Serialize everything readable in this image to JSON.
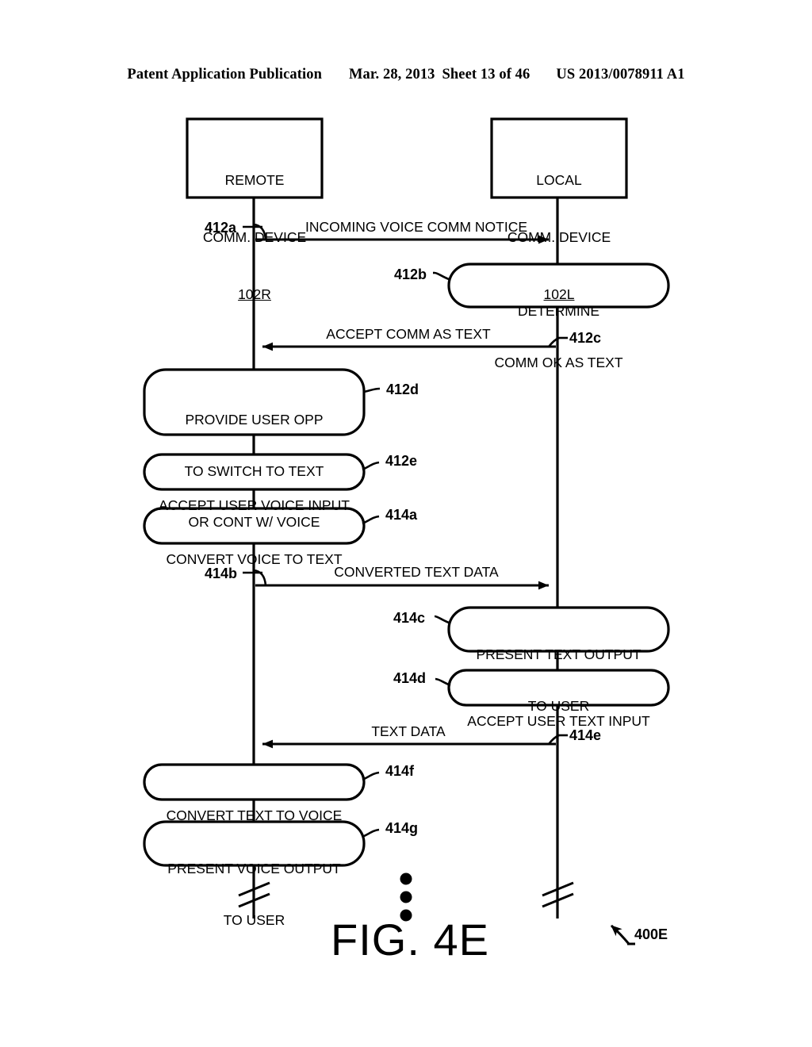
{
  "header": {
    "publication": "Patent Application Publication",
    "date": "Mar. 28, 2013",
    "sheet": "Sheet 13 of 46",
    "patent_number": "US 2013/0078911 A1"
  },
  "figure": {
    "title": "FIG. 4E",
    "figure_ref": "400E",
    "ellipsis_icon": "vertical-ellipsis"
  },
  "lifelines": [
    {
      "id": "remote",
      "title_line1": "REMOTE",
      "title_line2": "COMM. DEVICE",
      "ref": "102R"
    },
    {
      "id": "local",
      "title_line1": "LOCAL",
      "title_line2": "COMM. DEVICE",
      "ref": "102L"
    }
  ],
  "messages": [
    {
      "id": "412a",
      "ref": "412a",
      "label": "INCOMING VOICE COMM NOTICE",
      "direction": "right"
    },
    {
      "id": "412c",
      "ref": "412c",
      "label": "ACCEPT COMM AS TEXT",
      "direction": "left"
    },
    {
      "id": "414b",
      "ref": "414b",
      "label": "CONVERTED TEXT DATA",
      "direction": "right"
    },
    {
      "id": "414e",
      "ref": "414e",
      "label": "TEXT DATA",
      "direction": "left"
    }
  ],
  "steps": [
    {
      "id": "412b",
      "ref": "412b",
      "side": "local",
      "lines": [
        "DETERMINE",
        "COMM OK AS TEXT"
      ]
    },
    {
      "id": "412d",
      "ref": "412d",
      "side": "remote",
      "lines": [
        "PROVIDE USER OPP",
        "TO SWITCH TO TEXT",
        "OR CONT W/ VOICE"
      ]
    },
    {
      "id": "412e",
      "ref": "412e",
      "side": "remote",
      "lines": [
        "ACCEPT USER VOICE INPUT"
      ]
    },
    {
      "id": "414a",
      "ref": "414a",
      "side": "remote",
      "lines": [
        "CONVERT VOICE TO TEXT"
      ]
    },
    {
      "id": "414c",
      "ref": "414c",
      "side": "local",
      "lines": [
        "PRESENT TEXT OUTPUT",
        "TO USER"
      ]
    },
    {
      "id": "414d",
      "ref": "414d",
      "side": "local",
      "lines": [
        "ACCEPT USER TEXT INPUT"
      ]
    },
    {
      "id": "414f",
      "ref": "414f",
      "side": "remote",
      "lines": [
        "CONVERT TEXT TO VOICE"
      ]
    },
    {
      "id": "414g",
      "ref": "414g",
      "side": "remote",
      "lines": [
        "PRESENT VOICE OUTPUT",
        "TO USER"
      ]
    }
  ],
  "colors": {
    "ink": "#000000",
    "paper": "#ffffff"
  }
}
